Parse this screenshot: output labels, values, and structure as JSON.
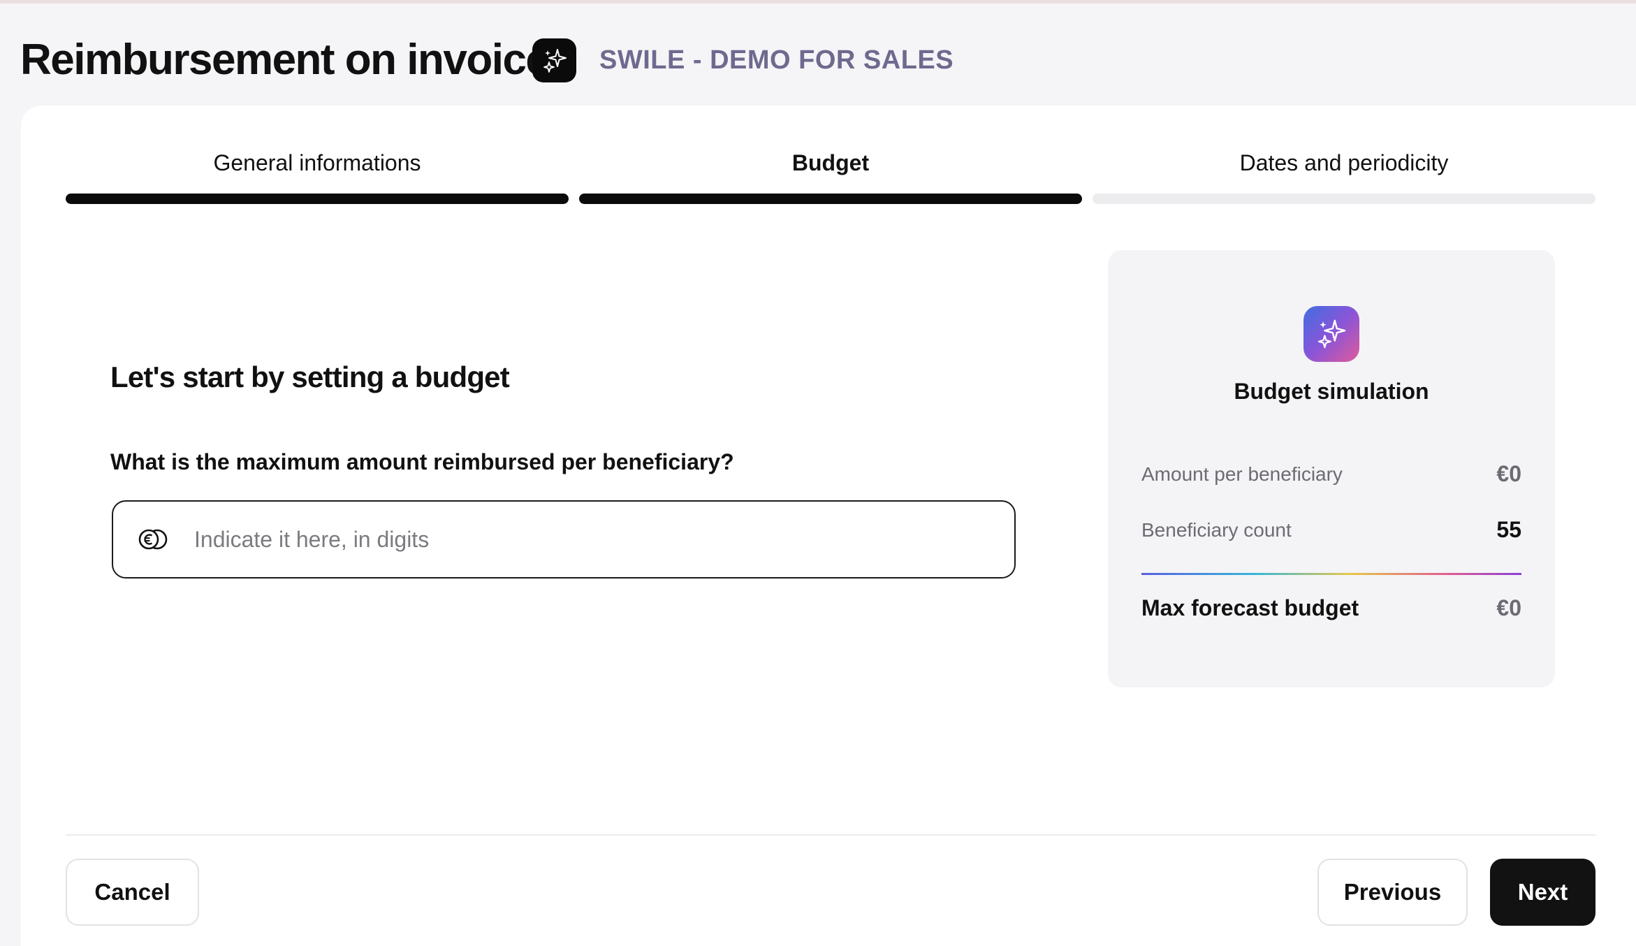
{
  "header": {
    "title": "Reimbursement on invoice",
    "app_icon": "sparkles-icon",
    "company": "SWILE - DEMO FOR SALES"
  },
  "steps": [
    {
      "label": "General informations",
      "state": "completed"
    },
    {
      "label": "Budget",
      "state": "active"
    },
    {
      "label": "Dates and periodicity",
      "state": "pending"
    }
  ],
  "form": {
    "title": "Let's start by setting a budget",
    "question": "What is the maximum amount reimbursed per beneficiary?",
    "amount_input": {
      "icon": "euro-coin-icon",
      "value": "",
      "placeholder": "Indicate it here, in digits"
    }
  },
  "simulation": {
    "icon": "sparkles-icon",
    "title": "Budget simulation",
    "amount_label": "Amount per beneficiary",
    "amount_value": "€0",
    "count_label": "Beneficiary count",
    "count_value": "55",
    "total_label": "Max forecast budget",
    "total_value": "€0"
  },
  "footer": {
    "cancel_label": "Cancel",
    "previous_label": "Previous",
    "next_label": "Next"
  },
  "colors": {
    "primary": "#121212",
    "company_text": "#6e6a8e",
    "panel_bg": "#f4f4f7",
    "progress_done": "#0b0b0b",
    "progress_pending": "#ececee"
  }
}
